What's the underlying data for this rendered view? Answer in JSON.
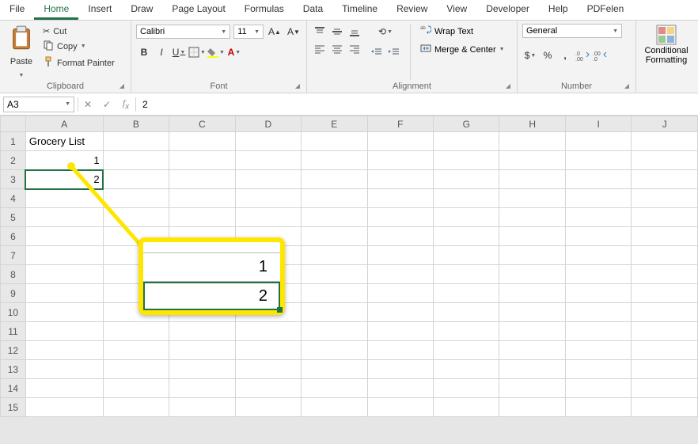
{
  "tabs": [
    "File",
    "Home",
    "Insert",
    "Draw",
    "Page Layout",
    "Formulas",
    "Data",
    "Timeline",
    "Review",
    "View",
    "Developer",
    "Help",
    "PDFelen"
  ],
  "active_tab": "Home",
  "clipboard": {
    "paste": "Paste",
    "cut": "Cut",
    "copy": "Copy",
    "format_painter": "Format Painter",
    "title": "Clipboard"
  },
  "font": {
    "name": "Calibri",
    "size": "11",
    "title": "Font"
  },
  "alignment": {
    "wrap": "Wrap Text",
    "merge": "Merge & Center",
    "title": "Alignment"
  },
  "number": {
    "format": "General",
    "title": "Number"
  },
  "styles": {
    "cond": "Conditional Formatting"
  },
  "name_box": "A3",
  "formula_value": "2",
  "columns": [
    "A",
    "B",
    "C",
    "D",
    "E",
    "F",
    "G",
    "H",
    "I",
    "J"
  ],
  "rows": [
    "1",
    "2",
    "3",
    "4",
    "5",
    "6",
    "7",
    "8",
    "9",
    "10",
    "11",
    "12",
    "13",
    "14",
    "15"
  ],
  "cells": {
    "A1": "Grocery List",
    "A2": "1",
    "A3": "2"
  },
  "callout": {
    "val1": "1",
    "val2": "2"
  }
}
